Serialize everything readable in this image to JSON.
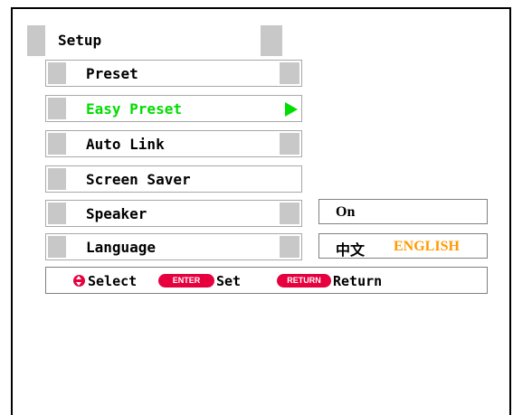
{
  "setup": {
    "title": "Setup"
  },
  "menu": {
    "items": [
      {
        "label": "Preset",
        "active": false
      },
      {
        "label": "Easy Preset",
        "active": true
      },
      {
        "label": "Auto Link",
        "active": false
      },
      {
        "label": "Screen Saver",
        "active": false
      },
      {
        "label": "Speaker",
        "active": false
      },
      {
        "label": "Language",
        "active": false
      }
    ]
  },
  "options": {
    "speaker_value": "On",
    "language_zh": "中文",
    "language_en": "ENGLISH"
  },
  "help": {
    "select_label": "Select",
    "enter_key": "ENTER",
    "set_label": "Set",
    "return_key": "RETURN",
    "return_label": "Return"
  },
  "colors": {
    "active_text": "#00dd00",
    "selected_option": "#ff9900",
    "key_pill": "#e6003e",
    "block_gray": "#c8c8c8"
  }
}
